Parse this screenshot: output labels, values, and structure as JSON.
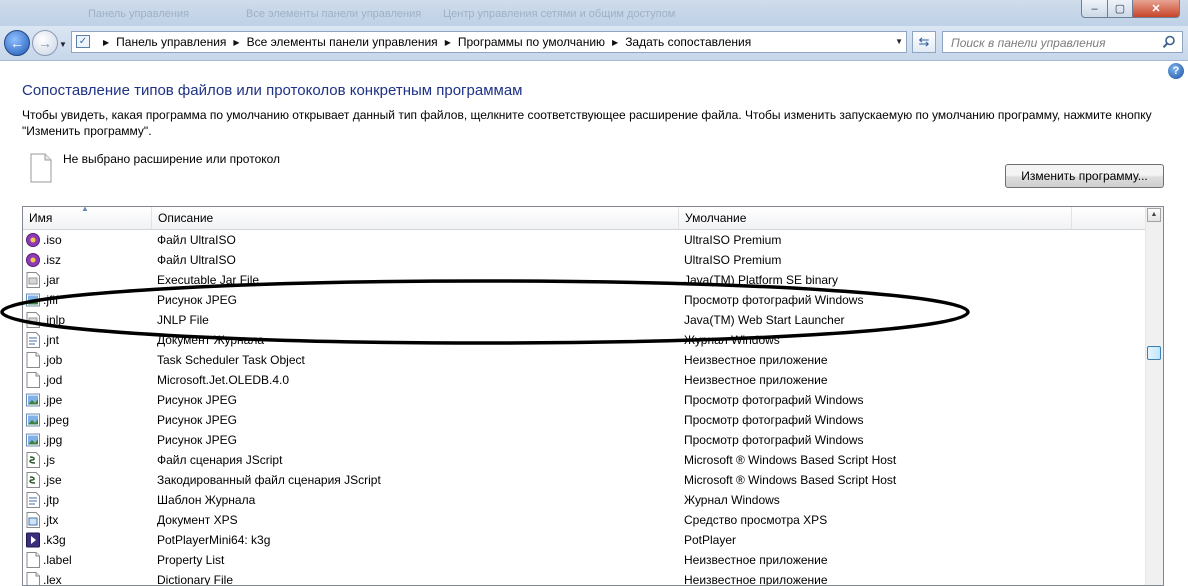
{
  "window": {
    "ghost_breadcrumbs": [
      "Панель управления",
      "Все элементы панели управления",
      "Центр управления сетями и общим доступом"
    ]
  },
  "address": {
    "crumbs": [
      "Панель управления",
      "Все элементы панели управления",
      "Программы по умолчанию",
      "Задать сопоставления"
    ]
  },
  "search": {
    "placeholder": "Поиск в панели управления"
  },
  "page": {
    "title": "Сопоставление типов файлов или протоколов конкретным программам",
    "description": "Чтобы увидеть, какая программа по умолчанию открывает данный тип файлов, щелкните соответствующее расширение файла. Чтобы изменить запускаемую по умолчанию программу, нажмите кнопку \"Изменить программу\".",
    "selection_text": "Не выбрано расширение или протокол",
    "change_button": "Изменить программу..."
  },
  "list": {
    "columns": [
      "Имя",
      "Описание",
      "Умолчание"
    ],
    "rows": [
      {
        "name": ".iso",
        "description": "Файл UltraISO",
        "default": "UltraISO Premium",
        "icon": "ultraiso-icon"
      },
      {
        "name": ".isz",
        "description": "Файл UltraISO",
        "default": "UltraISO Premium",
        "icon": "ultraiso-icon"
      },
      {
        "name": ".jar",
        "description": "Executable Jar File",
        "default": "Java(TM) Platform SE binary",
        "icon": "java-file-icon"
      },
      {
        "name": ".jfif",
        "description": "Рисунок JPEG",
        "default": "Просмотр фотографий Windows",
        "icon": "image-file-icon"
      },
      {
        "name": ".jnlp",
        "description": "JNLP File",
        "default": "Java(TM) Web Start Launcher",
        "icon": "java-file-icon"
      },
      {
        "name": ".jnt",
        "description": "Документ Журнала",
        "default": "Журнал Windows",
        "icon": "journal-file-icon"
      },
      {
        "name": ".job",
        "description": "Task Scheduler Task Object",
        "default": "Неизвестное приложение",
        "icon": "blank-file-icon"
      },
      {
        "name": ".jod",
        "description": "Microsoft.Jet.OLEDB.4.0",
        "default": "Неизвестное приложение",
        "icon": "blank-file-icon"
      },
      {
        "name": ".jpe",
        "description": "Рисунок JPEG",
        "default": "Просмотр фотографий Windows",
        "icon": "image-file-icon"
      },
      {
        "name": ".jpeg",
        "description": "Рисунок JPEG",
        "default": "Просмотр фотографий Windows",
        "icon": "image-file-icon"
      },
      {
        "name": ".jpg",
        "description": "Рисунок JPEG",
        "default": "Просмотр фотографий Windows",
        "icon": "image-file-icon"
      },
      {
        "name": ".js",
        "description": "Файл сценария JScript",
        "default": "Microsoft ® Windows Based Script Host",
        "icon": "script-file-icon"
      },
      {
        "name": ".jse",
        "description": "Закодированный файл сценария JScript",
        "default": "Microsoft ® Windows Based Script Host",
        "icon": "script-file-icon"
      },
      {
        "name": ".jtp",
        "description": "Шаблон Журнала",
        "default": "Журнал Windows",
        "icon": "journal-file-icon"
      },
      {
        "name": ".jtx",
        "description": "Документ XPS",
        "default": "Средство просмотра XPS",
        "icon": "xps-file-icon"
      },
      {
        "name": ".k3g",
        "description": "PotPlayerMini64: k3g",
        "default": "PotPlayer",
        "icon": "potplayer-icon"
      },
      {
        "name": ".label",
        "description": "Property List",
        "default": "Неизвестное приложение",
        "icon": "blank-file-icon"
      },
      {
        "name": ".lex",
        "description": "Dictionary File",
        "default": "Неизвестное приложение",
        "icon": "blank-file-icon"
      }
    ]
  }
}
